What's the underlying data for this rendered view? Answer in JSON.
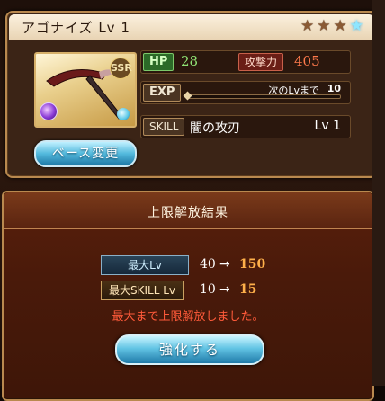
{
  "weapon_card": {
    "title": "アゴナイズ Lv 1",
    "rarity_badge": "SSR",
    "stars": [
      {
        "icon": "star-bronze-icon"
      },
      {
        "icon": "star-bronze-icon"
      },
      {
        "icon": "star-bronze-icon"
      },
      {
        "icon": "star-blue-icon"
      }
    ],
    "hp_label": "HP",
    "hp_value": "28",
    "atk_label": "攻撃力",
    "atk_value": "405",
    "exp_label": "EXP",
    "next_lv_label": "次のLvまで",
    "next_lv_value": "10",
    "exp_progress": 0,
    "skill_label": "SKILL",
    "skill_name": "闇の攻刃",
    "skill_level": "Lv 1",
    "base_change_button": "ベース変更"
  },
  "result_dialog": {
    "title": "上限解放結果",
    "max_lv_label": "最大Lv",
    "max_lv_from": "40",
    "max_lv_to": "150",
    "max_skill_label": "最大SKILL Lv",
    "max_skill_from": "10",
    "max_skill_to": "15",
    "arrow": "→",
    "notice": "最大まで上限解放しました。",
    "enhance_button": "強化する"
  },
  "colors": {
    "hp": "#8fe274",
    "atk": "#ff7a4c",
    "upgrade_value": "#ffb04a",
    "notice": "#ff5a3a"
  }
}
